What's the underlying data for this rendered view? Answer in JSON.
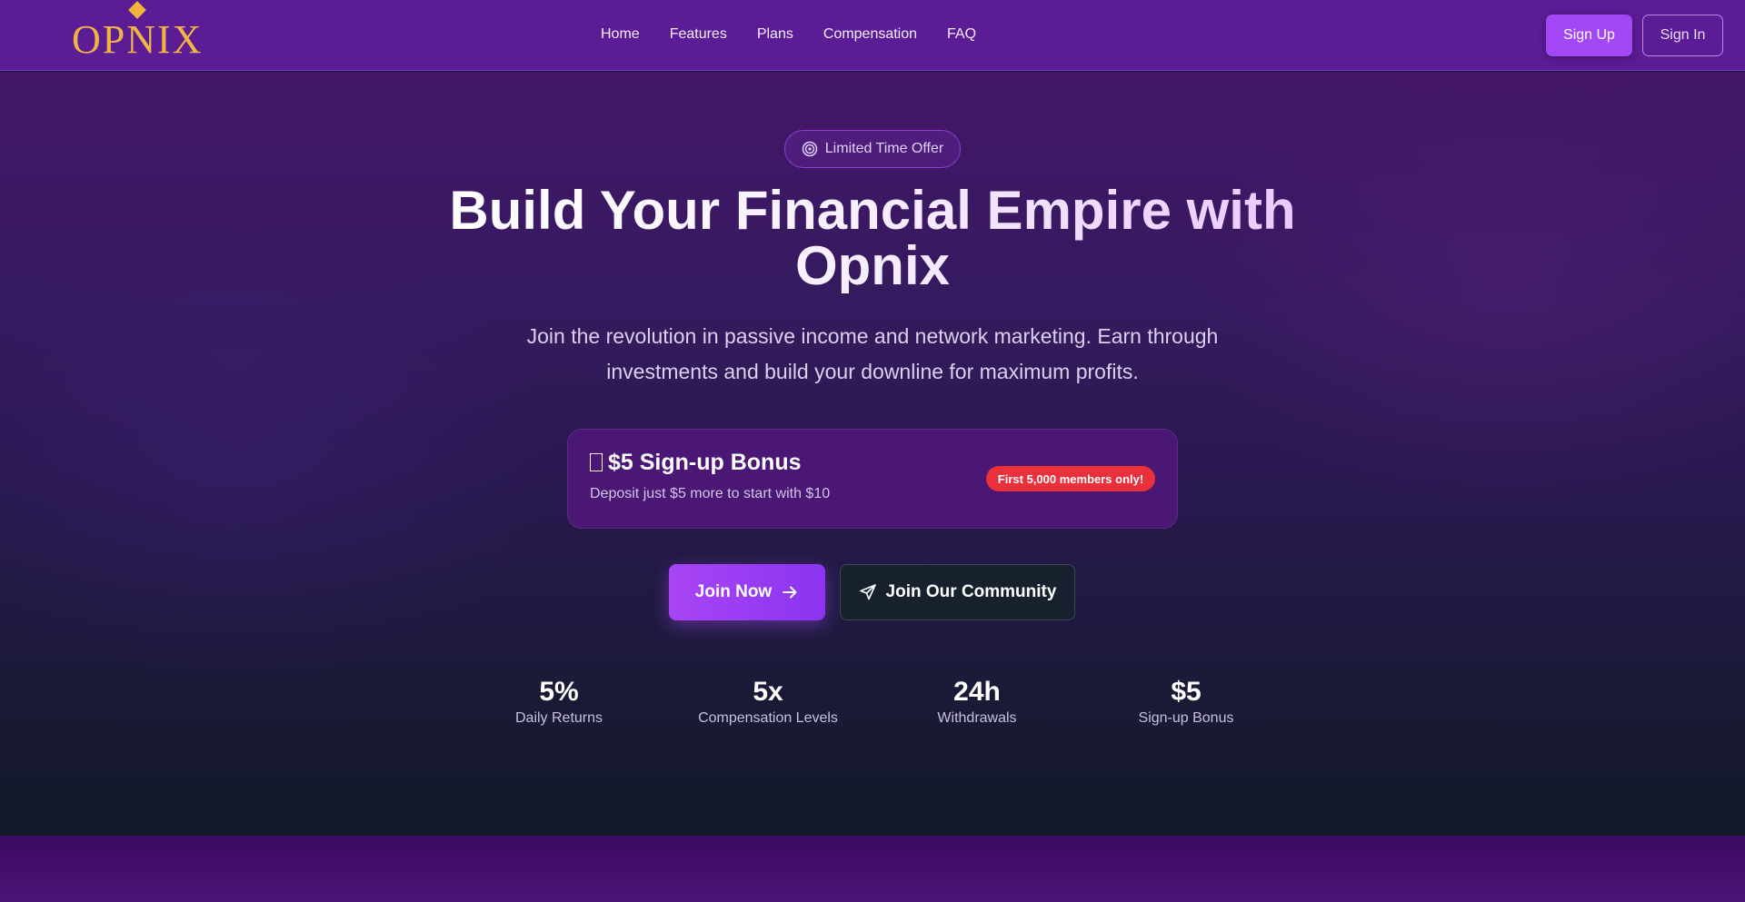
{
  "brand": {
    "logo_text": "OPNIX",
    "accent": "#f0b445",
    "primary": "#a247f4"
  },
  "nav": {
    "links": [
      "Home",
      "Features",
      "Plans",
      "Compensation",
      "FAQ"
    ],
    "signup_label": "Sign Up",
    "signin_label": "Sign In"
  },
  "hero": {
    "badge_label": "Limited Time Offer",
    "title": "Build Your Financial Empire with Opnix",
    "subtitle": "Join the revolution in passive income and network marketing. Earn through investments and build your downline for maximum profits.",
    "bonus": {
      "icon": "gift-icon",
      "title": "$5 Sign-up Bonus",
      "description": "Deposit just $5 more to start with $10",
      "pill": "First 5,000 members only!"
    },
    "join_label": "Join Now",
    "community_label": "Join Our Community",
    "stats": [
      {
        "value": "5%",
        "label": "Daily Returns"
      },
      {
        "value": "5x",
        "label": "Compensation Levels"
      },
      {
        "value": "24h",
        "label": "Withdrawals"
      },
      {
        "value": "$5",
        "label": "Sign-up Bonus"
      }
    ]
  }
}
